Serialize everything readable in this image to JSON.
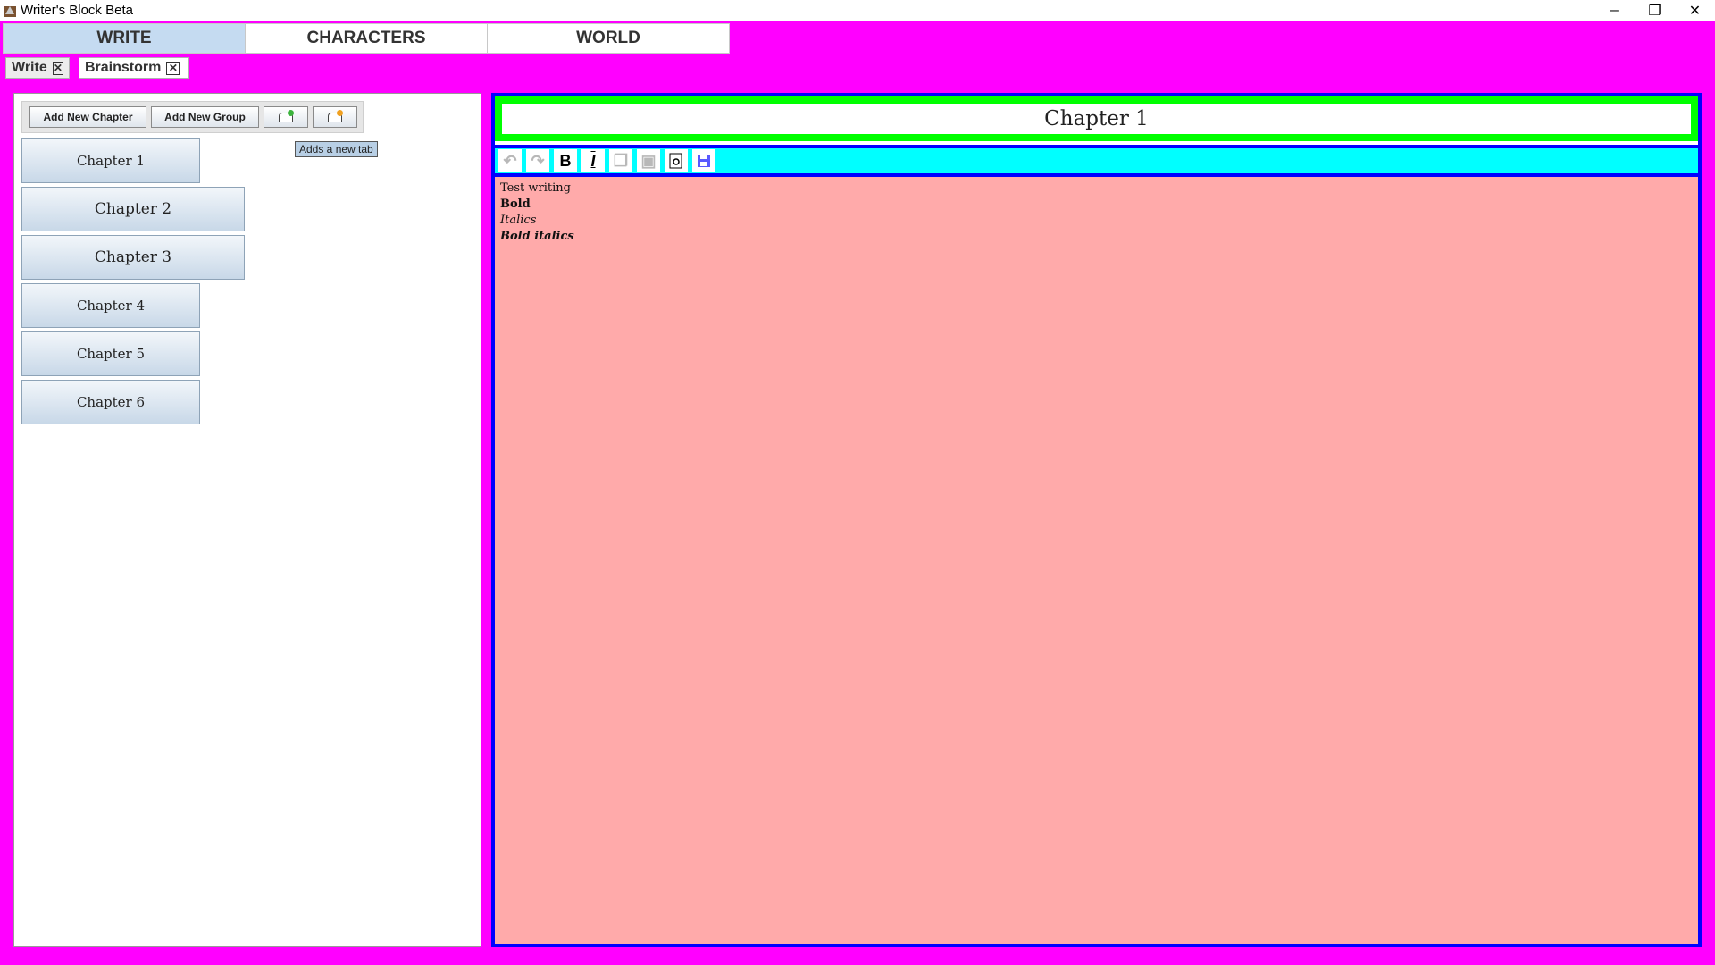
{
  "window": {
    "title": "Writer's Block Beta"
  },
  "main_tabs": [
    {
      "label": "WRITE",
      "active": true
    },
    {
      "label": "CHARACTERS",
      "active": false
    },
    {
      "label": "WORLD",
      "active": false
    }
  ],
  "sub_tabs": [
    {
      "label": "Write",
      "active": false
    },
    {
      "label": "Brainstorm",
      "active": true
    }
  ],
  "toolbar": {
    "add_chapter": "Add New Chapter",
    "add_group": "Add New Group",
    "tooltip": "Adds a new tab"
  },
  "chapters": [
    "Chapter 1",
    "Chapter 2",
    "Chapter 3",
    "Chapter 4",
    "Chapter 5",
    "Chapter 6"
  ],
  "editor": {
    "chapter_title": "Chapter 1",
    "lines": [
      "Test writing",
      "Bold",
      "Italics",
      "Bold italics"
    ]
  },
  "colors": {
    "background": "#ff00ff",
    "editor_border": "#0000ff",
    "title_border": "#00ff00",
    "format_bar": "#00ffff",
    "editor_bg": "#ffaaaa"
  },
  "icons": [
    "undo-icon",
    "redo-icon",
    "bold-icon",
    "italic-icon",
    "copy-icon",
    "paste-icon",
    "preview-icon",
    "save-icon"
  ]
}
